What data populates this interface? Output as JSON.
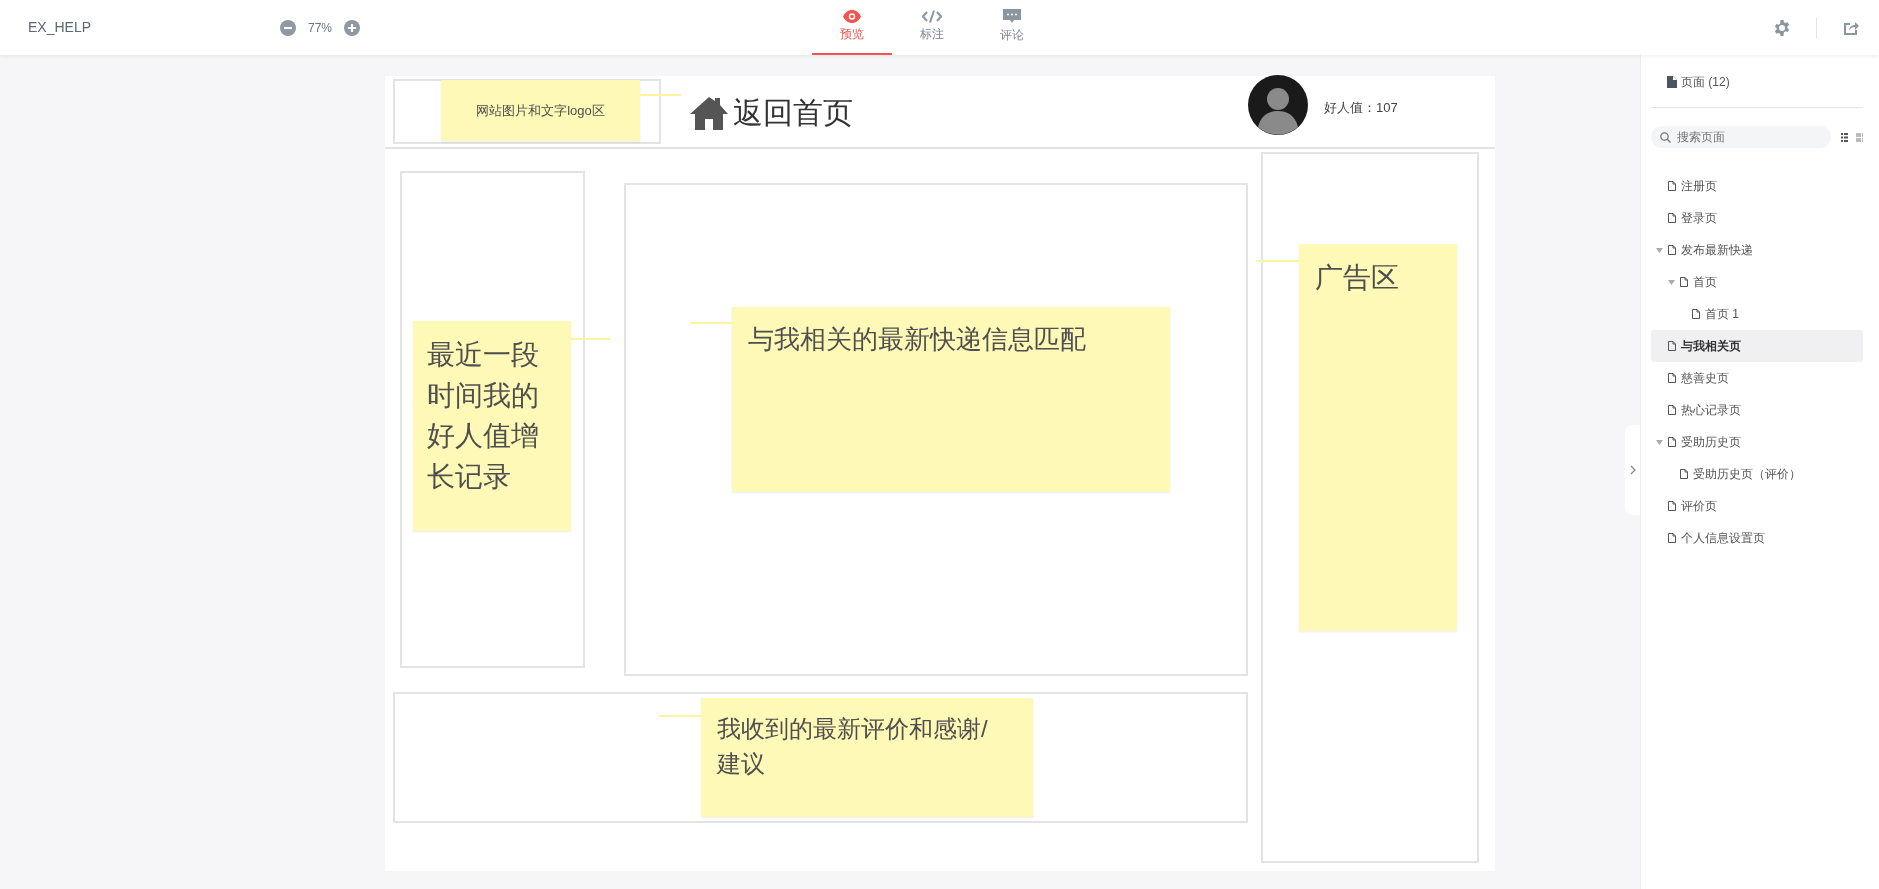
{
  "toolbar": {
    "project": "EX_HELP",
    "zoom": "77%"
  },
  "tabs": [
    {
      "label": "预览",
      "selected": true
    },
    {
      "label": "标注",
      "selected": false
    },
    {
      "label": "评论",
      "selected": false
    }
  ],
  "canvas": {
    "logo_note": "网站图片和文字logo区",
    "home_link": "返回首页",
    "score": "好人值：107",
    "notes": [
      {
        "text": "最近一段时间我的好人值增长记录"
      },
      {
        "text": "与我相关的最新快递信息匹配"
      },
      {
        "text": "广告区"
      },
      {
        "text": "我收到的最新评价和感谢/建议"
      }
    ]
  },
  "sidebar": {
    "title": "页面 (12)",
    "search": {
      "placeholder": "搜索页面"
    },
    "pages": [
      {
        "label": "注册页",
        "selected": false
      },
      {
        "label": "登录页",
        "selected": false
      },
      {
        "label": "发布最新快递",
        "selected": false,
        "expanded": true,
        "children": [
          {
            "label": "首页",
            "selected": false,
            "expanded": true,
            "children": [
              {
                "label": "首页 1",
                "selected": false
              }
            ]
          }
        ]
      },
      {
        "label": "与我相关页",
        "selected": true
      },
      {
        "label": "慈善史页",
        "selected": false
      },
      {
        "label": "热心记录页",
        "selected": false
      },
      {
        "label": "受助历史页",
        "selected": false,
        "expanded": true,
        "children": [
          {
            "label": "受助历史页（评价）",
            "selected": false
          }
        ]
      },
      {
        "label": "评价页",
        "selected": false
      },
      {
        "label": "个人信息设置页",
        "selected": false
      }
    ]
  }
}
